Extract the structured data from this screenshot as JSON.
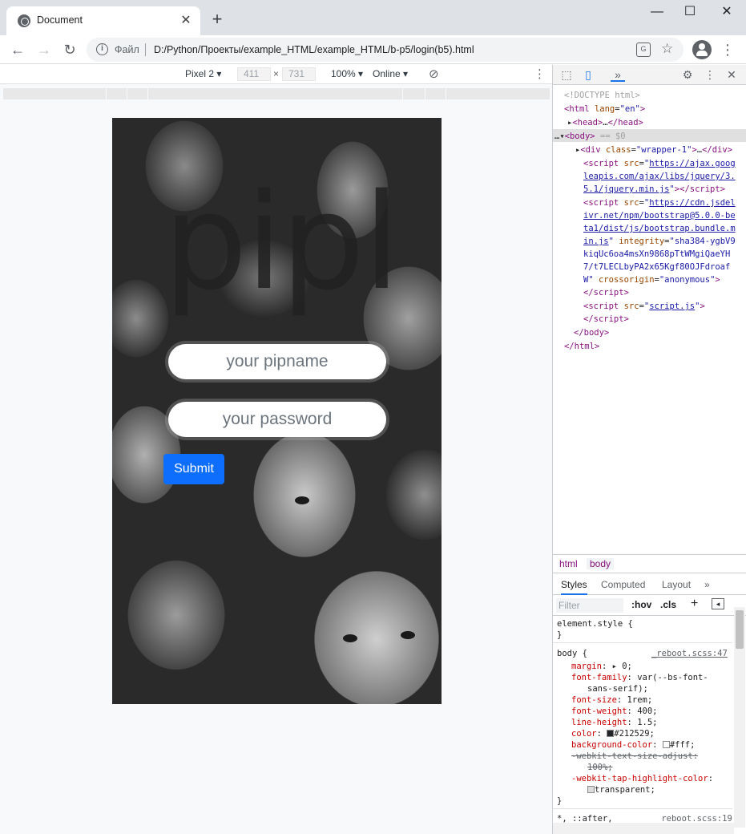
{
  "browser": {
    "tab_title": "Document",
    "url_protocol": "Файл",
    "url": "D:/Python/Проекты/example_HTML/example_HTML/b-p5/login(b5).html"
  },
  "device_toolbar": {
    "device": "Pixel 2",
    "width": "411",
    "x": "×",
    "height": "731",
    "zoom": "100%",
    "network": "Online"
  },
  "page": {
    "brand": "pipl",
    "username_placeholder": "your pipname",
    "password_placeholder": "your password",
    "submit_label": "Submit"
  },
  "devtools": {
    "crumbs": [
      "html",
      "body"
    ],
    "subtabs": [
      "Styles",
      "Computed",
      "Layout"
    ],
    "filter_placeholder": "Filter",
    "hov": ":hov",
    "cls": ".cls",
    "element_style": "element.style {",
    "body_selector": "body {",
    "body_source": "_reboot.scss:47",
    "after_selector": "*, ::after,",
    "after_source": "_reboot.scss:19"
  }
}
